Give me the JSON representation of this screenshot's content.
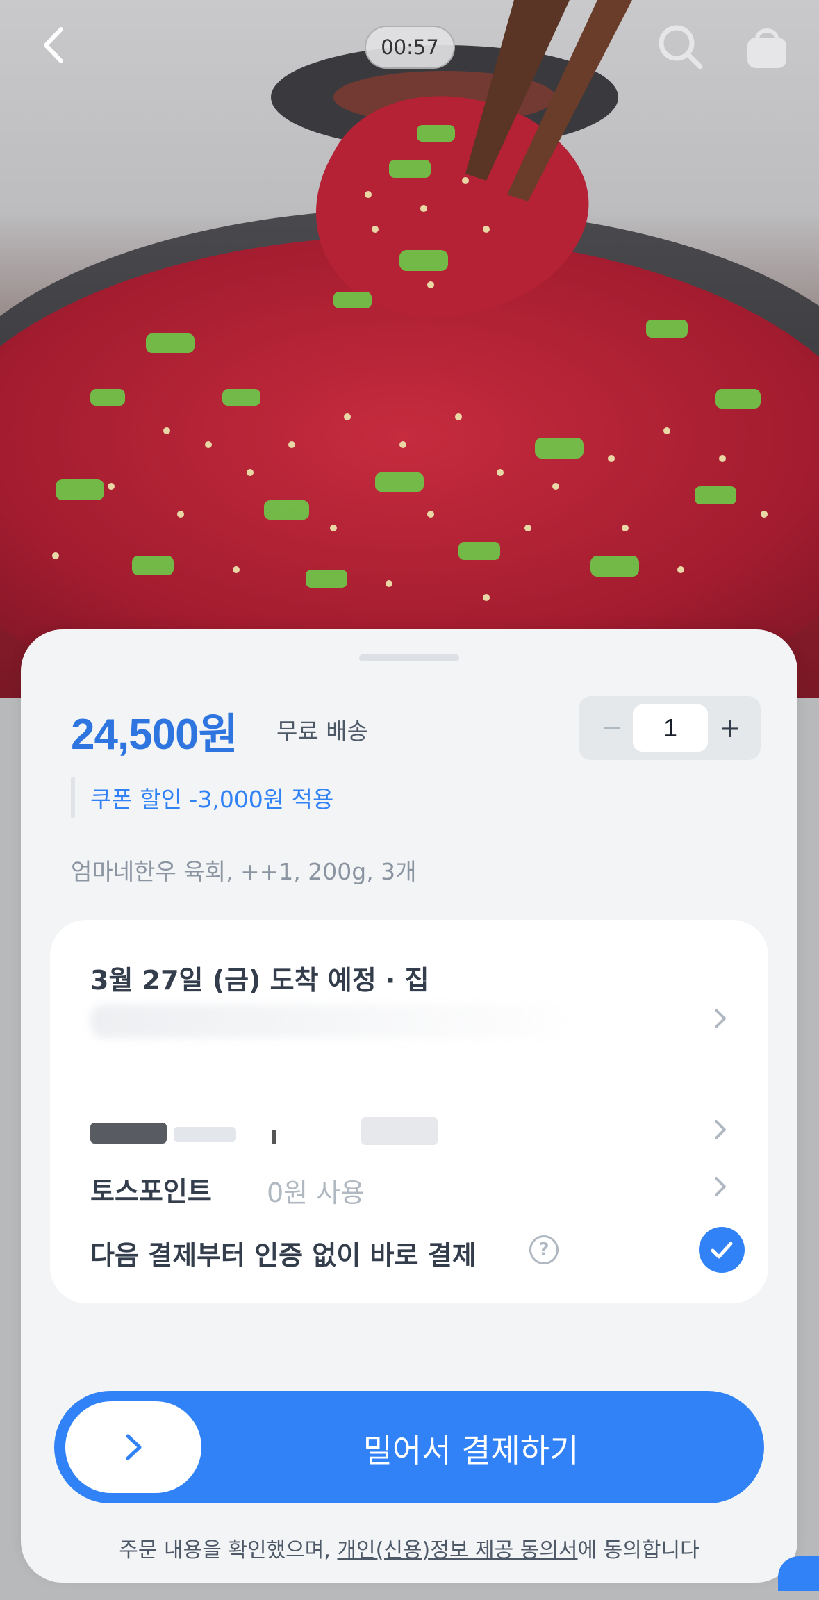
{
  "top_bar": {
    "timer": "00:57",
    "back_icon": "chevron-left-icon",
    "search_icon": "search-icon",
    "cart_icon": "shopping-bag-icon"
  },
  "hero": {
    "image_name": "beef-tartare-photo"
  },
  "product": {
    "price": "24,500원",
    "shipping": "무료 배송",
    "coupon": "쿠폰 할인 -3,000원 적용",
    "description": "엄마네한우 육회, ++1, 200g, 3개",
    "quantity": "1",
    "minus_label": "−",
    "plus_label": "+"
  },
  "checkout_card": {
    "delivery": "3월 27일 (금) 도착 예정 · 집",
    "points_label": "토스포인트",
    "points_value": "0원 사용",
    "quick_pay_label": "다음 결제부터 인증 없이 바로 결제",
    "help_glyph": "?",
    "quick_pay_checked": true
  },
  "pay": {
    "slide_label": "밀어서 결제하기",
    "agreement_prefix": "주문 내용을 확인했으며, ",
    "agreement_link": "개인(신용)정보 제공 동의서",
    "agreement_suffix": "에 동의합니다"
  },
  "colors": {
    "accent": "#3182f6",
    "price": "#2f75e0",
    "sheet_bg": "#f2f4f6"
  }
}
